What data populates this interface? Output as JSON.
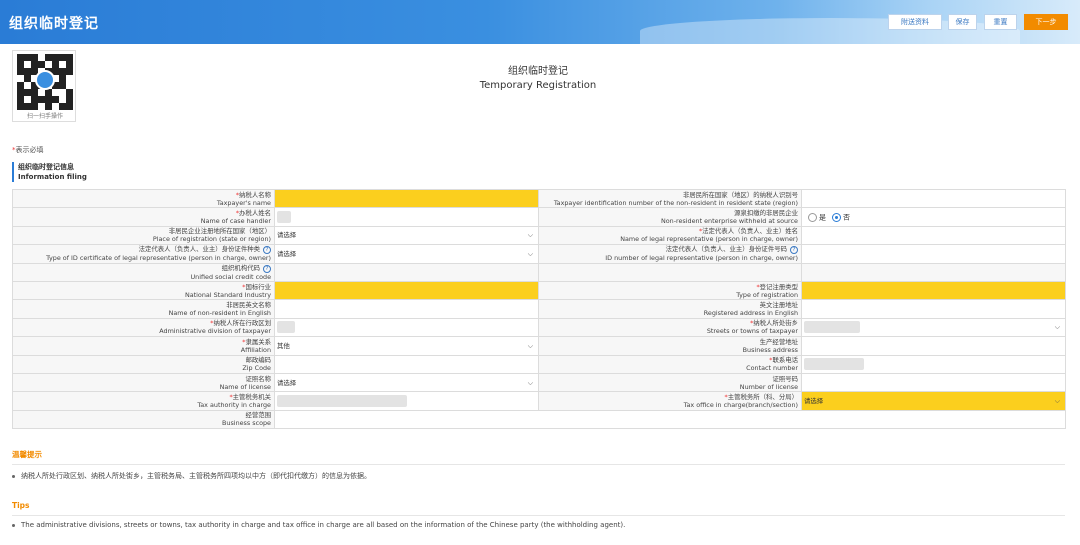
{
  "header": {
    "title": "组织临时登记",
    "buttons": {
      "attach": "附送资料",
      "save": "保存",
      "reset": "重置",
      "next": "下一步"
    }
  },
  "qr": {
    "caption": "扫一扫手操作"
  },
  "page_title": {
    "zh": "组织临时登记",
    "en": "Temporary Registration"
  },
  "required_note": {
    "star": "*",
    "text": "表示必填"
  },
  "section": {
    "zh": "组织临时登记信息",
    "en": "Information filing"
  },
  "select_placeholder": "请选择",
  "radio": {
    "yes": "是",
    "no": "否",
    "selected": "否"
  },
  "fields": {
    "taxpayer_name": {
      "zh": "纳税人名称",
      "en": "Taxpayer's name"
    },
    "tin_nonresident": {
      "zh": "非居民所在国家（地区）的纳税人识别号",
      "en": "Taxpayer identification number of the non-resident in resident state (region)"
    },
    "case_handler": {
      "zh": "办税人姓名",
      "en": "Name of case handler"
    },
    "withheld": {
      "zh": "源泉扣缴的非居民企业",
      "en": "Non-resident enterprise withheld at source"
    },
    "place_registration": {
      "zh": "非居民企业注册地所在国家（地区）",
      "en": "Place of registration (state or region)"
    },
    "legal_rep_name": {
      "zh": "法定代表人（负责人、业主）姓名",
      "en": "Name of legal representative (person in charge, owner)"
    },
    "id_type": {
      "zh": "法定代表人（负责人、业主）身份证件种类",
      "en": "Type of ID certificate of legal representative (person in charge, owner)"
    },
    "id_number": {
      "zh": "法定代表人（负责人、业主）身份证件号码",
      "en": "ID number of legal representative (person in charge, owner)"
    },
    "credit_code": {
      "zh": "组织机构代码",
      "en": "Unified social credit code"
    },
    "industry": {
      "zh": "国标行业",
      "en": "National Standard Industry"
    },
    "reg_type": {
      "zh": "登记注册类型",
      "en": "Type of registration"
    },
    "name_en": {
      "zh": "非居民英文名称",
      "en": "Name of non-resident in English"
    },
    "address_en": {
      "zh": "英文注册地址",
      "en": "Registered address in English"
    },
    "admin_division": {
      "zh": "纳税人所在行政区划",
      "en": "Administrative division of taxpayer"
    },
    "streets": {
      "zh": "纳税人所处街乡",
      "en": "Streets or towns of taxpayer"
    },
    "affiliation": {
      "zh": "隶属关系",
      "en": "Affiliation",
      "value": "其他"
    },
    "business_address": {
      "zh": "生产经营地址",
      "en": "Business address"
    },
    "zip": {
      "zh": "邮政编码",
      "en": "Zip Code"
    },
    "contact": {
      "zh": "联系电话",
      "en": "Contact number"
    },
    "license_name": {
      "zh": "证照名称",
      "en": "Name of license"
    },
    "license_number": {
      "zh": "证照号码",
      "en": "Number of license"
    },
    "tax_authority": {
      "zh": "主管税务机关",
      "en": "Tax authority in charge"
    },
    "tax_office": {
      "zh": "主管税务所（科、分局）",
      "en": "Tax office in charge(branch/section)"
    },
    "scope": {
      "zh": "经营范围",
      "en": "Business scope"
    }
  },
  "tips": {
    "zh_title": "温馨提示",
    "zh_text": "纳税人所处行政区划、纳税人所处街乡，主管税务局、主管税务所四项均以中方（即代扣代缴方）的信息为依据。",
    "en_title": "Tips",
    "en_text": "The administrative divisions, streets or towns, tax authority in charge and tax office in charge are all based on the information of the Chinese party (the withholding agent)."
  },
  "colors": {
    "header_blue": "#2a7cd6",
    "highlight_yellow": "#fbcf1e",
    "next_orange": "#f28b00",
    "required_red": "#e33"
  }
}
